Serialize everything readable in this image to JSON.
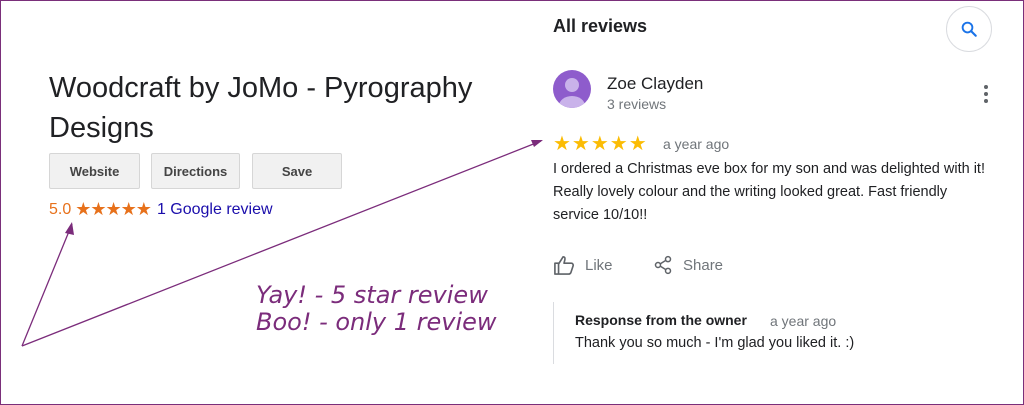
{
  "business": {
    "title": "Woodcraft by JoMo - Pyrography Designs",
    "buttons": {
      "website": "Website",
      "directions": "Directions",
      "save": "Save"
    },
    "rating": "5.0",
    "stars": "★★★★★",
    "review_link": "1 Google review"
  },
  "reviews": {
    "heading": "All reviews",
    "reviewer": {
      "name": "Zoe Clayden",
      "count": "3 reviews",
      "avatar_color": "#8e5ccc"
    },
    "stars": "★★★★★",
    "rating": 5,
    "time": "a year ago",
    "text": "I ordered a Christmas eve box for my son and was delighted with it! Really lovely colour and the writing looked great. Fast friendly service 10/10!!",
    "actions": {
      "like": "Like",
      "share": "Share"
    },
    "owner_response": {
      "title": "Response from the owner",
      "time": "a year ago",
      "text": "Thank you so much - I'm glad you liked it. :)"
    }
  },
  "annotation": {
    "line1": "Yay! - 5 star review",
    "line2": "Boo! - only 1 review",
    "color": "#7b2c7b"
  },
  "colors": {
    "star_orange": "#e7711b",
    "star_yellow": "#fbbc04",
    "link": "#1a0dab",
    "search_blue": "#1a73e8"
  },
  "icons": [
    "search-icon",
    "more-vert-icon",
    "thumb-up-icon",
    "share-icon",
    "person-icon"
  ]
}
